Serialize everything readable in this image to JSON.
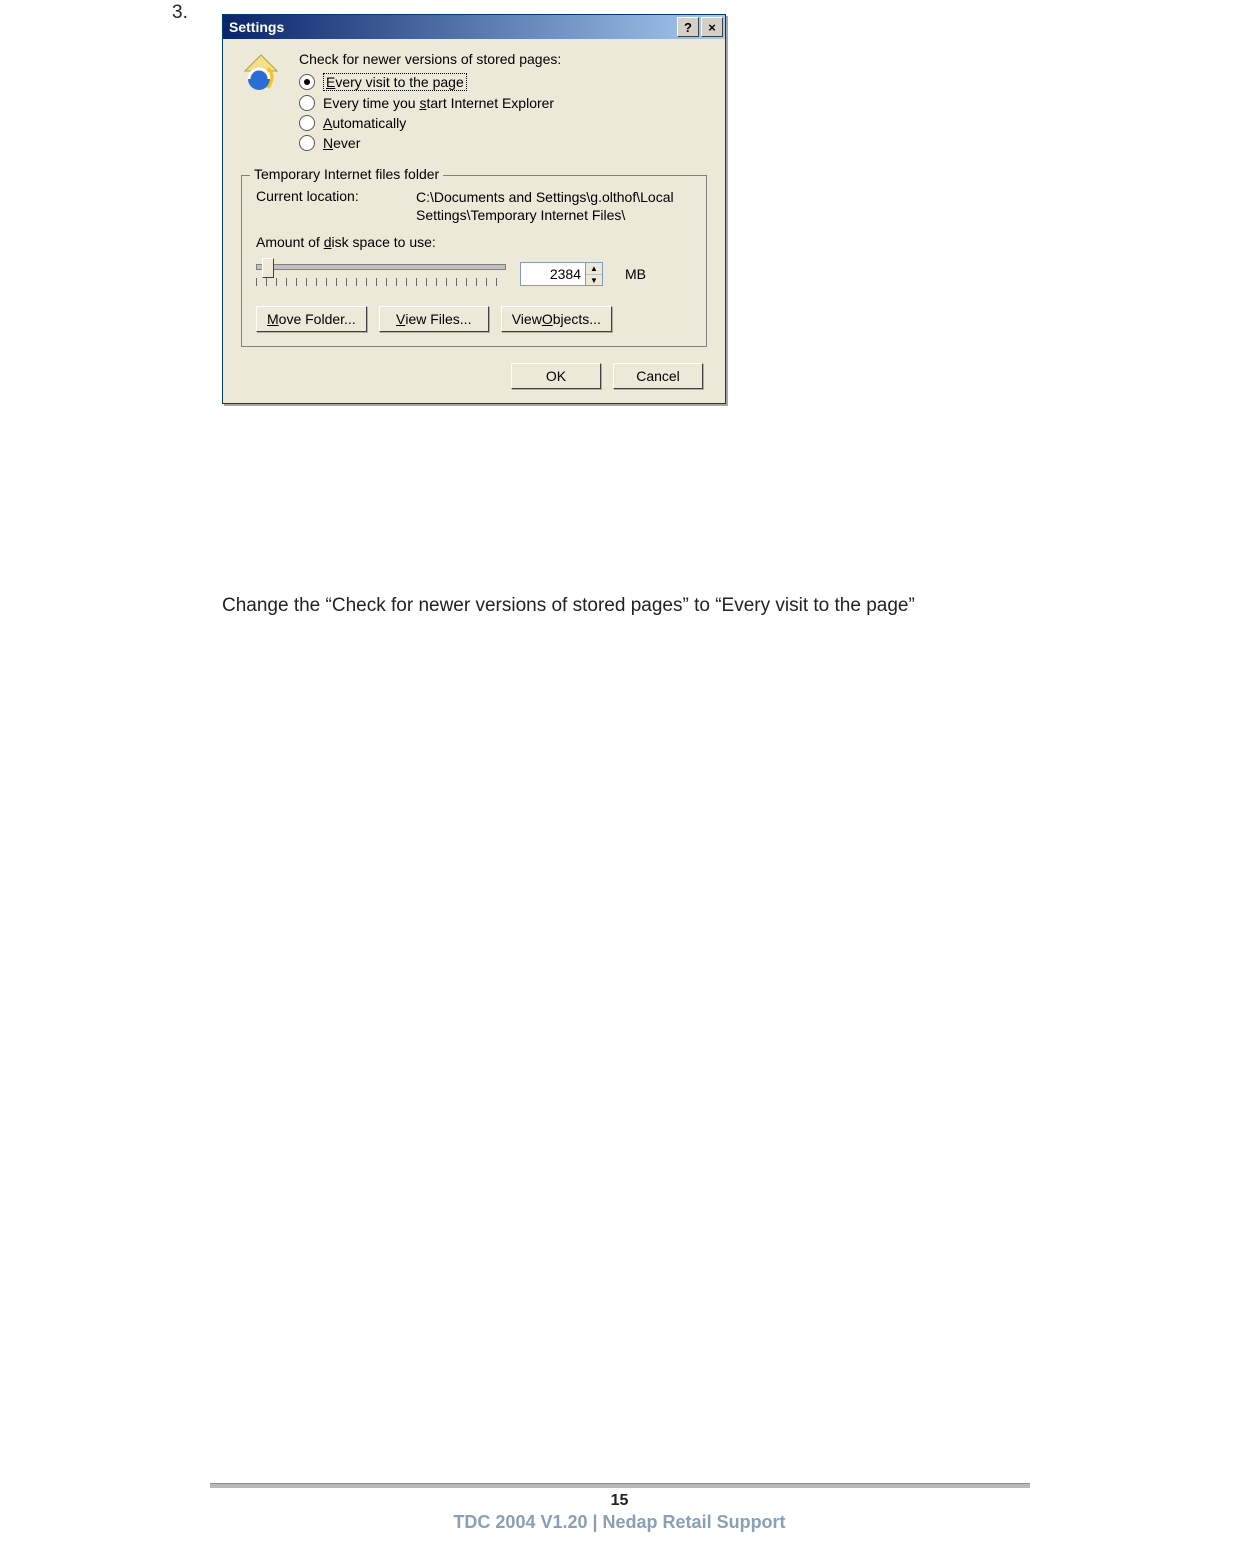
{
  "step_number": "3.",
  "dialog": {
    "title": "Settings",
    "help_glyph": "?",
    "close_glyph": "×",
    "radio_heading": "Check for newer versions of stored pages:",
    "radios": {
      "every_visit": "Every visit to the page",
      "e_underline": "E",
      "every_visit_rest": "very visit to the page",
      "every_start": "Every time you ",
      "s_underline": "s",
      "every_start_rest": "tart Internet Explorer",
      "auto_a": "A",
      "auto_rest": "utomatically",
      "never_n": "N",
      "never_rest": "ever",
      "selected_index": 0
    },
    "group_title": "Temporary Internet files folder",
    "current_location_label": "Current location:",
    "current_location_value": "C:\\Documents and Settings\\g.olthof\\Local Settings\\Temporary Internet Files\\",
    "amount_label_pre": "Amount of ",
    "amount_d": "d",
    "amount_label_post": "isk space to use:",
    "disk_value": "2384",
    "mb_label": "MB",
    "buttons": {
      "move_m": "M",
      "move_rest": "ove Folder...",
      "view_files_v": "V",
      "view_files_rest": "iew Files...",
      "view_objects_pre": "View ",
      "view_objects_o": "O",
      "view_objects_rest": "bjects..."
    },
    "ok_label": "OK",
    "cancel_label": "Cancel"
  },
  "caption": "Change the  “Check for newer versions of stored pages” to “Every visit to the page”",
  "footer": {
    "page": "15",
    "text": "TDC 2004 V1.20 | Nedap Retail Support"
  }
}
